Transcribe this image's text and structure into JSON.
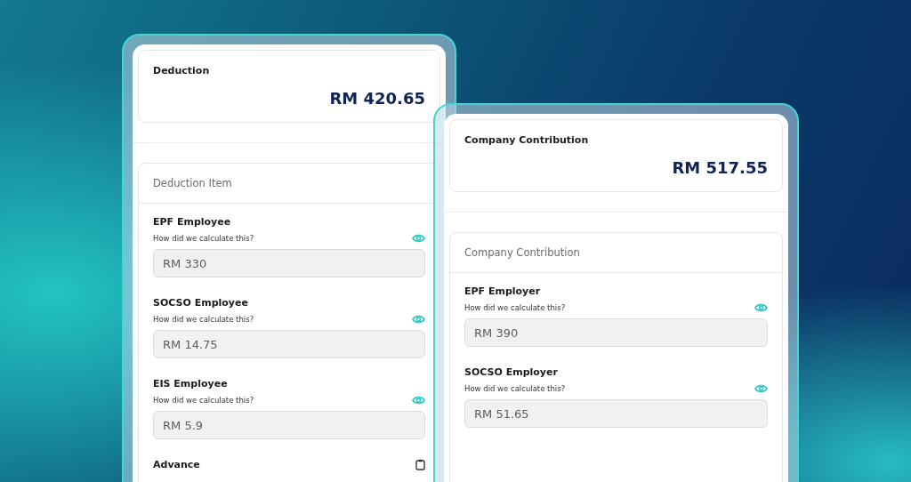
{
  "panels": [
    {
      "summary": {
        "title": "Deduction",
        "amount": "RM 420.65"
      },
      "section_title": "Deduction Item",
      "items": [
        {
          "kind": "calculated",
          "label": "EPF Employee",
          "hint": "How did we calculate this?",
          "value": "RM 330"
        },
        {
          "kind": "calculated",
          "label": "SOCSO Employee",
          "hint": "How did we calculate this?",
          "value": "RM 14.75"
        },
        {
          "kind": "calculated",
          "label": "EIS Employee",
          "hint": "How did we calculate this?",
          "value": "RM 5.9"
        },
        {
          "kind": "heading",
          "label": "Advance"
        }
      ]
    },
    {
      "summary": {
        "title": "Company Contribution",
        "amount": "RM 517.55"
      },
      "section_title": "Company Contribution",
      "items": [
        {
          "kind": "calculated",
          "label": "EPF Employer",
          "hint": "How did we calculate this?",
          "value": "RM 390"
        },
        {
          "kind": "calculated",
          "label": "SOCSO Employer",
          "hint": "How did we calculate this?",
          "value": "RM 51.65"
        }
      ]
    }
  ]
}
